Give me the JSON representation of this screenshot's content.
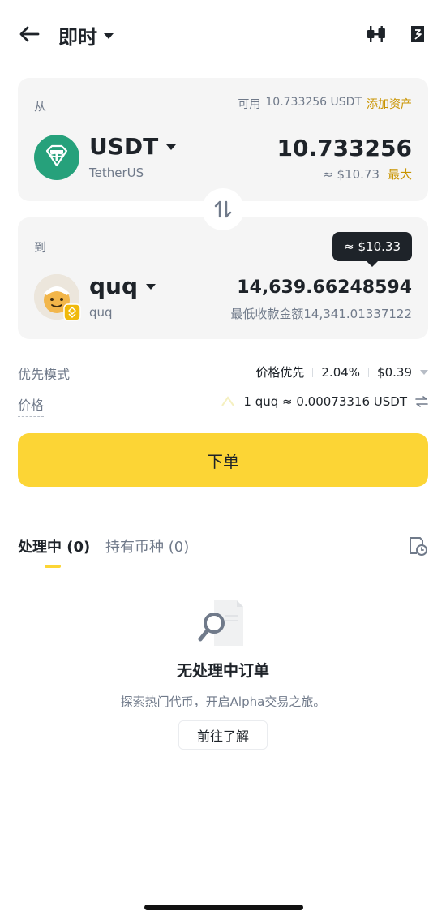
{
  "header": {
    "title": "即时",
    "back_icon": "arrow-left-icon",
    "chart_icon": "candlestick-chart-icon",
    "order_icon": "order-history-icon"
  },
  "from": {
    "label": "从",
    "available_label": "可用",
    "available_value": "10.733256 USDT",
    "add_asset": "添加资产",
    "coin": "USDT",
    "coin_full": "TetherUS",
    "amount": "10.733256",
    "usd_value": "≈ $10.73",
    "max_label": "最大"
  },
  "to": {
    "label": "到",
    "tooltip": "≈ $10.33",
    "coin": "quq",
    "coin_full": "quq",
    "amount": "14,639.66248594",
    "min_receive": "最低收款金额14,341.01337122"
  },
  "priority": {
    "label": "优先模式",
    "mode": "价格优先",
    "percent": "2.04%",
    "fee": "$0.39"
  },
  "price": {
    "label": "价格",
    "rate": "1 quq ≈ 0.00073316 USDT"
  },
  "order_button": "下单",
  "tabs": [
    {
      "label": "处理中 (0)"
    },
    {
      "label": "持有币种 (0)"
    }
  ],
  "empty": {
    "title": "无处理中订单",
    "subtitle": "探索热门代币，开启Alpha交易之旅。",
    "button": "前往了解"
  },
  "colors": {
    "accent": "#fcd535",
    "gold_text": "#c99400",
    "usdt_green": "#26a17b",
    "muted": "#707a8a"
  }
}
